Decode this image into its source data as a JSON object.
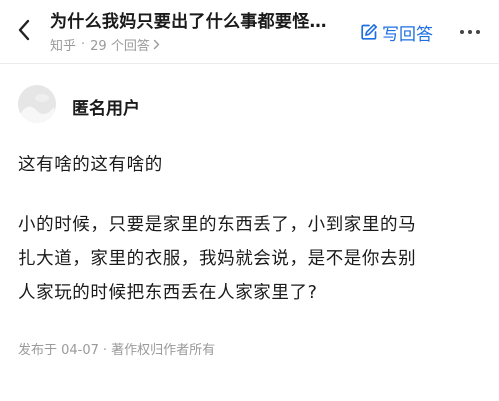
{
  "header": {
    "question_title": "为什么我妈只要出了什么事都要怪…",
    "source": "知乎",
    "answer_count": "29 个回答",
    "write_answer_label": "写回答"
  },
  "icons": {
    "back": "chevron-left-icon",
    "write": "edit-pen-icon",
    "more": "more-horizontal-icon",
    "answer_count_arrow": "chevron-right-icon"
  },
  "author": {
    "name": "匿名用户"
  },
  "answer": {
    "paragraph1": "这有啥的这有啥的",
    "paragraph2_lines": [
      "小的时候，只要是家里的东西丢了，小到家里的马",
      "扎大道，家里的衣服，我妈就会说，是不是你去别",
      "人家玩的时候把东西丢在人家家里了?"
    ]
  },
  "footer": {
    "published": "发布于 04-07",
    "copyright": "著作权归作者所有"
  },
  "colors": {
    "accent": "#1e6fe0",
    "meta_text": "#9a9a9a",
    "body_text": "#1a1a1a"
  }
}
